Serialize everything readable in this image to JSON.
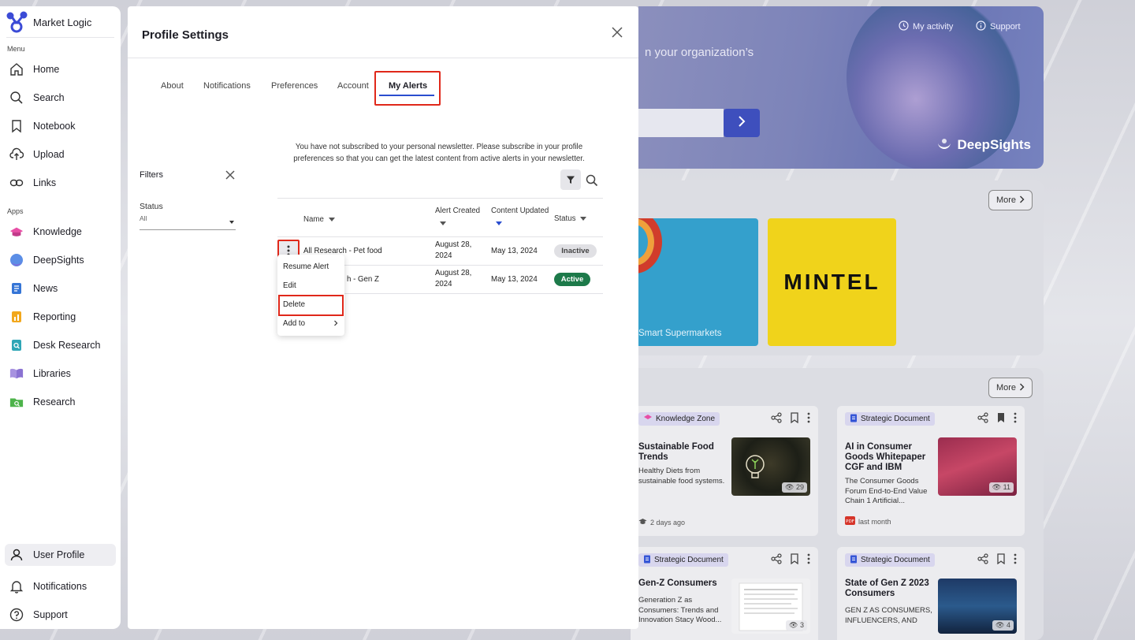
{
  "sidebar": {
    "brand": "Market Logic",
    "menu_label": "Menu",
    "menu_items": [
      "Home",
      "Search",
      "Notebook",
      "Upload",
      "Links"
    ],
    "apps_label": "Apps",
    "app_items": [
      "Knowledge",
      "DeepSights",
      "News",
      "Reporting",
      "Desk Research",
      "Libraries",
      "Research"
    ],
    "bottom_items": [
      "User Profile",
      "Notifications",
      "Support"
    ],
    "active_item": "User Profile"
  },
  "background": {
    "hero_text": "n your organization’s",
    "my_activity": "My activity",
    "support": "Support",
    "deepsights_logo": "DeepSights",
    "more_label": "More",
    "tile_text": "Smart Supermarkets",
    "mintel": "MINTEL",
    "cards": [
      {
        "tag": "Knowledge Zone",
        "title": "Sustainable Food Trends",
        "desc": "Healthy Diets from sustainable food systems.",
        "views": "29",
        "meta": "2 days ago"
      },
      {
        "tag": "Strategic Document",
        "title": "AI in Consumer Goods Whitepaper CGF and IBM",
        "desc": "The Consumer Goods Forum End-to-End Value Chain 1 Artificial...",
        "views": "11",
        "meta": "last month"
      },
      {
        "tag": "Strategic Document",
        "title": "Gen-Z Consumers",
        "desc": "Generation Z as Consumers: Trends and Innovation Stacy Wood...",
        "views": "3",
        "meta": ""
      },
      {
        "tag": "Strategic Document",
        "title": "State of Gen Z 2023 Consumers",
        "desc": "GEN Z AS CONSUMERS, INFLUENCERS, AND",
        "views": "4",
        "meta": ""
      }
    ]
  },
  "modal": {
    "title": "Profile Settings",
    "tabs": [
      "About",
      "Notifications",
      "Preferences",
      "Account",
      "My Alerts"
    ],
    "active_tab": "My Alerts",
    "filters_label": "Filters",
    "status_label": "Status",
    "status_value": "All",
    "notice_line1": "You have not subscribed to your personal newsletter. Please subscribe in your profile",
    "notice_line2": "preferences so that you can get the latest content from active alerts in your newsletter.",
    "table": {
      "headers": {
        "name": "Name",
        "created": "Alert Created",
        "updated": "Content Updated",
        "status": "Status"
      },
      "rows": [
        {
          "name": "All Research - Pet food",
          "created_1": "August 28,",
          "created_2": "2024",
          "updated": "May 13, 2024",
          "status": "Inactive"
        },
        {
          "name": "h - Gen Z",
          "created_1": "August 28,",
          "created_2": "2024",
          "updated": "May 13, 2024",
          "status": "Active"
        }
      ]
    },
    "row_menu": [
      "Resume Alert",
      "Edit",
      "Delete",
      "Add to"
    ]
  },
  "colors": {
    "accent": "#2a4dcf",
    "highlight": "#e0281a",
    "active_status": "#1d7a4a"
  }
}
